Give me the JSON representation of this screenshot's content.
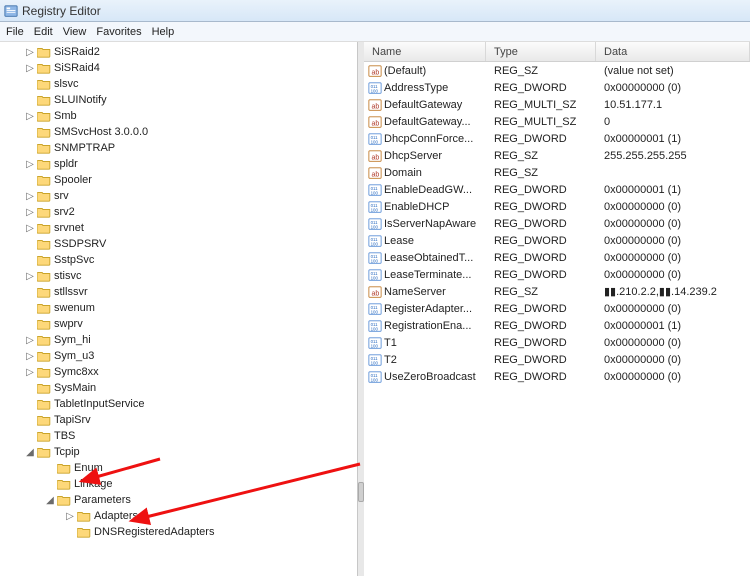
{
  "window": {
    "title": "Registry Editor"
  },
  "menu": {
    "items": [
      "File",
      "Edit",
      "View",
      "Favorites",
      "Help"
    ]
  },
  "tree": [
    {
      "label": "SiSRaid2",
      "indent": 1,
      "twisty": "▷",
      "icon": "folder"
    },
    {
      "label": "SiSRaid4",
      "indent": 1,
      "twisty": "▷",
      "icon": "folder"
    },
    {
      "label": "slsvc",
      "indent": 1,
      "twisty": "",
      "icon": "folder"
    },
    {
      "label": "SLUINotify",
      "indent": 1,
      "twisty": "",
      "icon": "folder"
    },
    {
      "label": "Smb",
      "indent": 1,
      "twisty": "▷",
      "icon": "folder"
    },
    {
      "label": "SMSvcHost 3.0.0.0",
      "indent": 1,
      "twisty": "",
      "icon": "folder"
    },
    {
      "label": "SNMPTRAP",
      "indent": 1,
      "twisty": "",
      "icon": "folder"
    },
    {
      "label": "spldr",
      "indent": 1,
      "twisty": "▷",
      "icon": "folder"
    },
    {
      "label": "Spooler",
      "indent": 1,
      "twisty": "",
      "icon": "folder"
    },
    {
      "label": "srv",
      "indent": 1,
      "twisty": "▷",
      "icon": "folder"
    },
    {
      "label": "srv2",
      "indent": 1,
      "twisty": "▷",
      "icon": "folder"
    },
    {
      "label": "srvnet",
      "indent": 1,
      "twisty": "▷",
      "icon": "folder"
    },
    {
      "label": "SSDPSRV",
      "indent": 1,
      "twisty": "",
      "icon": "folder"
    },
    {
      "label": "SstpSvc",
      "indent": 1,
      "twisty": "",
      "icon": "folder"
    },
    {
      "label": "stisvc",
      "indent": 1,
      "twisty": "▷",
      "icon": "folder"
    },
    {
      "label": "stllssvr",
      "indent": 1,
      "twisty": "",
      "icon": "folder"
    },
    {
      "label": "swenum",
      "indent": 1,
      "twisty": "",
      "icon": "folder"
    },
    {
      "label": "swprv",
      "indent": 1,
      "twisty": "",
      "icon": "folder"
    },
    {
      "label": "Sym_hi",
      "indent": 1,
      "twisty": "▷",
      "icon": "folder"
    },
    {
      "label": "Sym_u3",
      "indent": 1,
      "twisty": "▷",
      "icon": "folder"
    },
    {
      "label": "Symc8xx",
      "indent": 1,
      "twisty": "▷",
      "icon": "folder"
    },
    {
      "label": "SysMain",
      "indent": 1,
      "twisty": "",
      "icon": "folder"
    },
    {
      "label": "TabletInputService",
      "indent": 1,
      "twisty": "",
      "icon": "folder"
    },
    {
      "label": "TapiSrv",
      "indent": 1,
      "twisty": "",
      "icon": "folder"
    },
    {
      "label": "TBS",
      "indent": 1,
      "twisty": "",
      "icon": "folder"
    },
    {
      "label": "Tcpip",
      "indent": 1,
      "twisty": "◢",
      "icon": "folder"
    },
    {
      "label": "Enum",
      "indent": 2,
      "twisty": "",
      "icon": "folder"
    },
    {
      "label": "Linkage",
      "indent": 2,
      "twisty": "",
      "icon": "folder"
    },
    {
      "label": "Parameters",
      "indent": 2,
      "twisty": "◢",
      "icon": "folder"
    },
    {
      "label": "Adapters",
      "indent": 3,
      "twisty": "▷",
      "icon": "folder"
    },
    {
      "label": "DNSRegisteredAdapters",
      "indent": 3,
      "twisty": "",
      "icon": "folder"
    }
  ],
  "listHeaders": {
    "name": "Name",
    "type": "Type",
    "data": "Data"
  },
  "values": [
    {
      "icon": "sz",
      "name": "(Default)",
      "type": "REG_SZ",
      "data": "(value not set)"
    },
    {
      "icon": "bin",
      "name": "AddressType",
      "type": "REG_DWORD",
      "data": "0x00000000 (0)"
    },
    {
      "icon": "sz",
      "name": "DefaultGateway",
      "type": "REG_MULTI_SZ",
      "data": "10.51.177.1"
    },
    {
      "icon": "sz",
      "name": "DefaultGateway...",
      "type": "REG_MULTI_SZ",
      "data": "0"
    },
    {
      "icon": "bin",
      "name": "DhcpConnForce...",
      "type": "REG_DWORD",
      "data": "0x00000001 (1)"
    },
    {
      "icon": "sz",
      "name": "DhcpServer",
      "type": "REG_SZ",
      "data": "255.255.255.255"
    },
    {
      "icon": "sz",
      "name": "Domain",
      "type": "REG_SZ",
      "data": ""
    },
    {
      "icon": "bin",
      "name": "EnableDeadGW...",
      "type": "REG_DWORD",
      "data": "0x00000001 (1)"
    },
    {
      "icon": "bin",
      "name": "EnableDHCP",
      "type": "REG_DWORD",
      "data": "0x00000000 (0)"
    },
    {
      "icon": "bin",
      "name": "IsServerNapAware",
      "type": "REG_DWORD",
      "data": "0x00000000 (0)"
    },
    {
      "icon": "bin",
      "name": "Lease",
      "type": "REG_DWORD",
      "data": "0x00000000 (0)"
    },
    {
      "icon": "bin",
      "name": "LeaseObtainedT...",
      "type": "REG_DWORD",
      "data": "0x00000000 (0)"
    },
    {
      "icon": "bin",
      "name": "LeaseTerminate...",
      "type": "REG_DWORD",
      "data": "0x00000000 (0)"
    },
    {
      "icon": "sz",
      "name": "NameServer",
      "type": "REG_SZ",
      "data": "▮▮.210.2.2,▮▮.14.239.2"
    },
    {
      "icon": "bin",
      "name": "RegisterAdapter...",
      "type": "REG_DWORD",
      "data": "0x00000000 (0)"
    },
    {
      "icon": "bin",
      "name": "RegistrationEna...",
      "type": "REG_DWORD",
      "data": "0x00000001 (1)"
    },
    {
      "icon": "bin",
      "name": "T1",
      "type": "REG_DWORD",
      "data": "0x00000000 (0)"
    },
    {
      "icon": "bin",
      "name": "T2",
      "type": "REG_DWORD",
      "data": "0x00000000 (0)"
    },
    {
      "icon": "bin",
      "name": "UseZeroBroadcast",
      "type": "REG_DWORD",
      "data": "0x00000000 (0)"
    }
  ]
}
